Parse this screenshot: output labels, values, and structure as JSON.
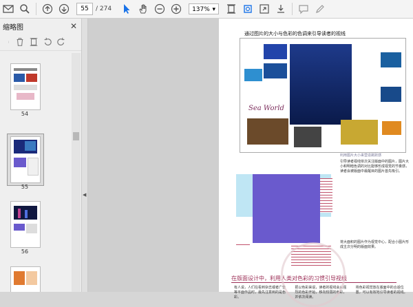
{
  "toolbar": {
    "page_current": "55",
    "page_total": "/ 274",
    "zoom": "137%",
    "zoom_arrow": "▾"
  },
  "sidebar": {
    "title": "缩略图",
    "close_glyph": "✕",
    "thumbnails": [
      {
        "label": "54"
      },
      {
        "label": "55"
      },
      {
        "label": "56"
      },
      {
        "label": ""
      }
    ]
  },
  "page": {
    "header": "通过图片的大小与色彩的色调来引导读者的视线",
    "sea_world": "Sea World",
    "caption_right": "利用图片大小来营造跳跃感",
    "body_right": "引导读者视线依次关注版面中的图片，图片大小和明暗色调的对比能够形成视觉的节奏感，读者会被版面中最醒目的图片首先吸引。",
    "body_right2": "将大面积的图片作为视觉中心，配合小图片形成主次分明的版面效果。",
    "section_title": "在版面设计中，利用人类对色彩的习惯引导视线",
    "body_bottom": [
      "有人说，人们在看到杂志或者广告等平面作品时，最先注意到的是色彩。",
      "把以色彩来说，读者的视线会从强烈的色彩开始，移向较弱的色彩，并依次阅读。",
      "将色彩视觉放在版面中的合适位置，可以有效地引导读者的视线。"
    ]
  },
  "colors": {
    "accent": "#9b2d55",
    "ocean": "#1a2a7a",
    "purple_block": "#6a5acd"
  }
}
